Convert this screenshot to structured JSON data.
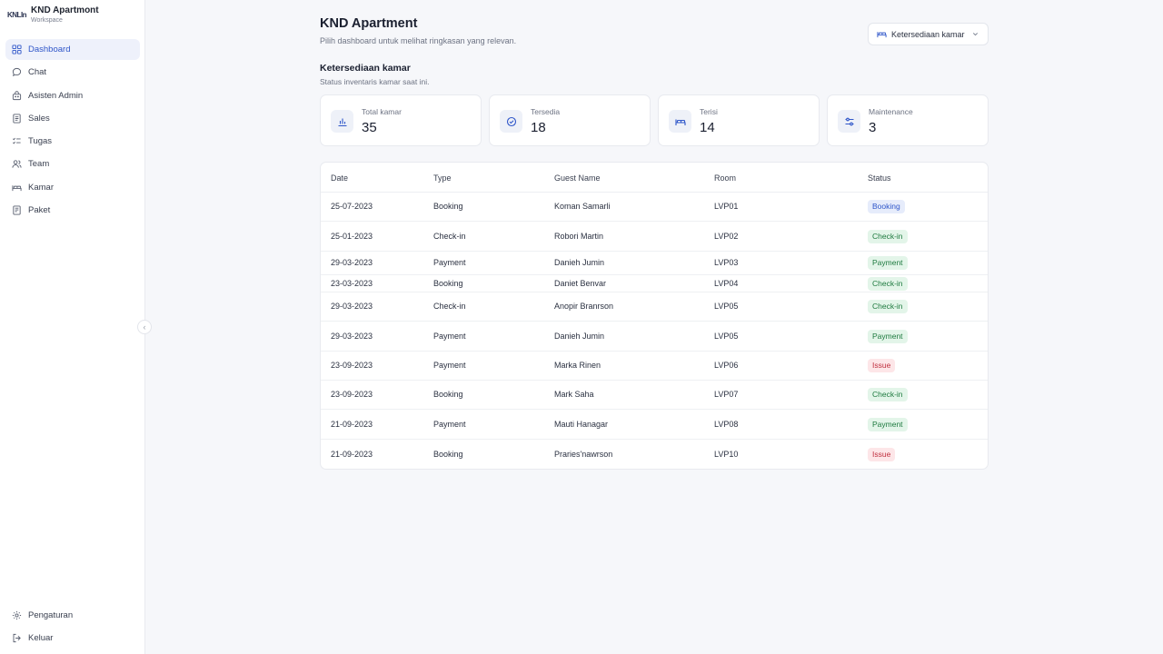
{
  "brand": {
    "logo": "KNLIn",
    "name": "KND Apartmont",
    "sub": "Workspace"
  },
  "sidebar": {
    "items": [
      {
        "label": "Dashboard",
        "icon": "grid-icon"
      },
      {
        "label": "Chat",
        "icon": "chat-icon"
      },
      {
        "label": "Asisten Admin",
        "icon": "assistant-icon"
      },
      {
        "label": "Sales",
        "icon": "document-icon"
      },
      {
        "label": "Tugas",
        "icon": "checklist-icon"
      },
      {
        "label": "Team",
        "icon": "users-icon"
      },
      {
        "label": "Kamar",
        "icon": "bed-icon"
      },
      {
        "label": "Paket",
        "icon": "package-icon"
      }
    ],
    "bottom": [
      {
        "label": "Pengaturan",
        "icon": "gear-icon"
      },
      {
        "label": "Keluar",
        "icon": "logout-icon"
      }
    ],
    "collapse_glyph": "‹"
  },
  "header": {
    "title": "KND Apartment",
    "subtitle": "Pilih dashboard untuk melihat ringkasan yang relevan.",
    "dashboard_select": "Ketersediaan kamar"
  },
  "section": {
    "title": "Ketersediaan kamar",
    "subtitle": "Status inventaris kamar saat ini."
  },
  "stats": [
    {
      "label": "Total kamar",
      "value": "35",
      "icon": "bar-chart-icon"
    },
    {
      "label": "Tersedia",
      "value": "18",
      "icon": "check-circle-icon"
    },
    {
      "label": "Terisi",
      "value": "14",
      "icon": "bed-icon"
    },
    {
      "label": "Maintenance",
      "value": "3",
      "icon": "sliders-icon"
    }
  ],
  "table": {
    "columns": [
      "Date",
      "Type",
      "Guest Name",
      "Room",
      "Status"
    ],
    "rows": [
      {
        "date": "25-07-2023",
        "type": "Booking",
        "guest": "Koman Samarli",
        "room": "LVP01",
        "status": "Booking"
      },
      {
        "date": "25-01-2023",
        "type": "Check-in",
        "guest": "Robori Martin",
        "room": "LVP02",
        "status": "Check-in"
      },
      {
        "date": "29-03-2023",
        "type": "Payment",
        "guest": "Danieh Jumin",
        "room": "LVP03",
        "status": "Payment"
      },
      {
        "date": "23-03-2023",
        "type": "Booking",
        "guest": "Daniet Benvar",
        "room": "LVP04",
        "status": "Check-in"
      },
      {
        "date": "29-03-2023",
        "type": "Check-in",
        "guest": "Anopir Branrson",
        "room": "LVP05",
        "status": "Check-in"
      },
      {
        "date": "29-03-2023",
        "type": "Payment",
        "guest": "Danieh Jumin",
        "room": "LVP05",
        "status": "Payment"
      },
      {
        "date": "23-09-2023",
        "type": "Payment",
        "guest": "Marka Rinen",
        "room": "LVP06",
        "status": "Issue"
      },
      {
        "date": "23-09-2023",
        "type": "Booking",
        "guest": "Mark Saha",
        "room": "LVP07",
        "status": "Check-in"
      },
      {
        "date": "21-09-2023",
        "type": "Payment",
        "guest": "Mauti Hanagar",
        "room": "LVP08",
        "status": "Payment"
      },
      {
        "date": "21-09-2023",
        "type": "Booking",
        "guest": "Praries'nawrson",
        "room": "LVP10",
        "status": "Issue"
      }
    ]
  },
  "colors": {
    "accent": "#2f56c9",
    "active_bg": "#eef1fb",
    "success_bg": "#e3f5e9",
    "success_fg": "#1e7a3f",
    "issue_bg": "#fde6e8",
    "issue_fg": "#c0303f"
  }
}
